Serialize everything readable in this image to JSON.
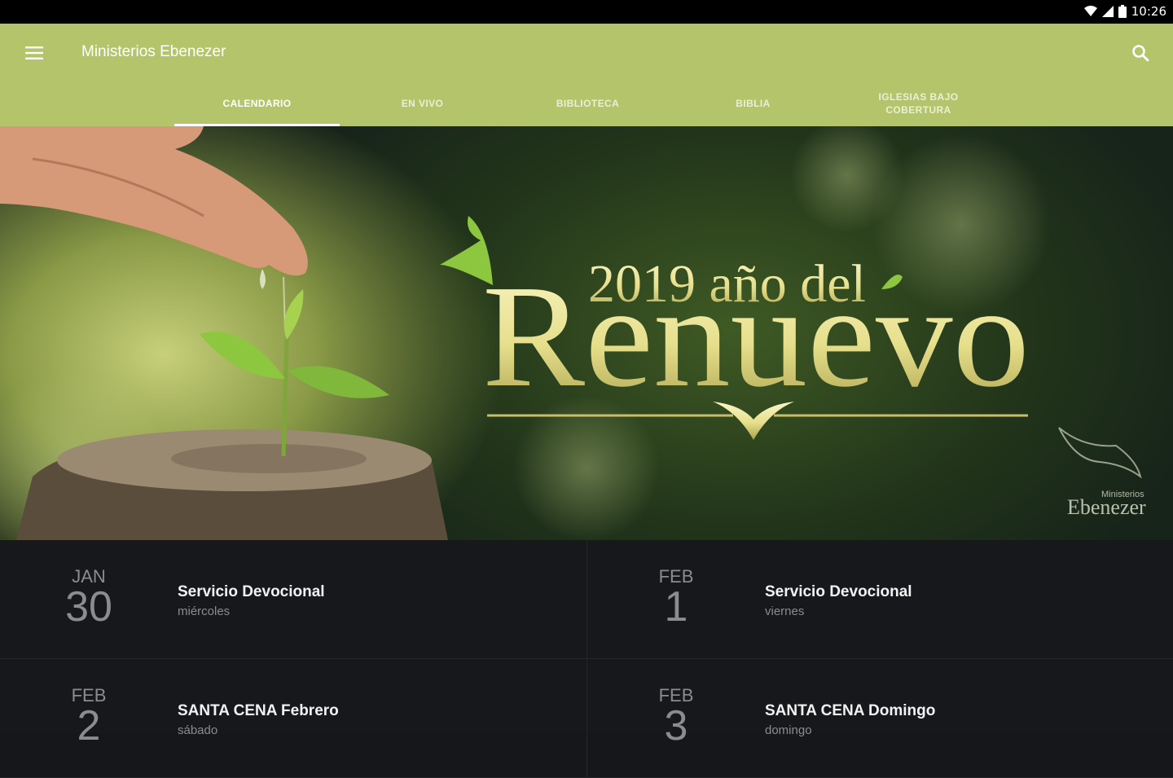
{
  "status_bar": {
    "time": "10:26"
  },
  "app_bar": {
    "title": "Ministerios Ebenezer"
  },
  "tabs": [
    {
      "label": "CALENDARIO",
      "active": true
    },
    {
      "label": "EN VIVO",
      "active": false
    },
    {
      "label": "BIBLIOTECA",
      "active": false
    },
    {
      "label": "BIBLIA",
      "active": false
    },
    {
      "label": "IGLESIAS BAJO COBERTURA",
      "active": false
    }
  ],
  "banner": {
    "headline_small": "2019 año del",
    "headline_big": "Renuevo",
    "logo_small": "Ministerios",
    "logo_big": "Ebenezer"
  },
  "events": [
    {
      "month": "JAN",
      "day": "30",
      "title": "Servicio Devocional",
      "weekday": "miércoles"
    },
    {
      "month": "FEB",
      "day": "1",
      "title": "Servicio Devocional",
      "weekday": "viernes"
    },
    {
      "month": "FEB",
      "day": "2",
      "title": "SANTA CENA Febrero",
      "weekday": "sábado"
    },
    {
      "month": "FEB",
      "day": "3",
      "title": "SANTA CENA Domingo",
      "weekday": "domingo"
    }
  ],
  "colors": {
    "app_bar": "#b4c46a",
    "list_bg": "#17181b",
    "status_bar": "#000000"
  }
}
